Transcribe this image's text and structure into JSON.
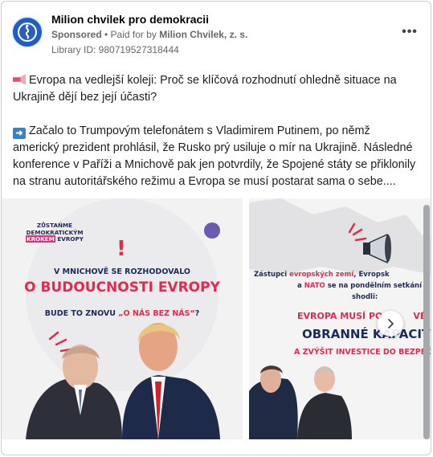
{
  "header": {
    "page_name": "Milion chvilek pro demokracii",
    "sponsored": "Sponsored",
    "paid_for_prefix": " • Paid for by ",
    "payer": "Milion Chvilek, z. s.",
    "library_id": "Library ID: 980719527318444",
    "more_label": "•••"
  },
  "post": {
    "paragraph1": "Evropa na vedlejší koleji: Proč se klíčová rozhodnutí ohledně situace na Ukrajině dějí bez její účasti?",
    "paragraph2": "Začalo to Trumpovým telefonátem s Vladimirem Putinem, po němž americký prezident prohlásil, že Rusko prý usiluje o mír na Ukrajině. Následné konference v Paříži a Mnichově pak jen potvrdily, že Spojené státy se přiklonily na stranu autoritářského režimu a Evropa se musí postarat sama o sebe...."
  },
  "slide1": {
    "tag_line1": "ZŮSTAŇME",
    "tag_line2": "DEMOKRATICKÝM",
    "tag_line3": "KROKEM",
    "tag_line4": "EVROPY",
    "line1": "V MNICHOVĚ SE ROZHODOVALO",
    "line2": "O BUDOUCNOSTI EVROPY",
    "line3_prefix": "BUDE TO ZNOVU ",
    "line3_quote": "„O NÁS BEZ NÁS“",
    "line3_suffix": "?"
  },
  "slide2": {
    "text_line1_a": "Zástupci ",
    "text_line1_b": "evropských zemí",
    "text_line1_c": ", Evropsk",
    "text_line2_a": "a ",
    "text_line2_b": "NATO",
    "text_line2_c": " se na pondělním setkání v",
    "text_line3": "shodli:",
    "headline1": "EVROPA MUSÍ PO",
    "headline1_end": "VÉ",
    "headline2": "OBRANNÉ KAPACITY",
    "headline3": "A ZVÝŠIT INVESTICE DO BEZPEČ"
  },
  "colors": {
    "pink": "#e5294f",
    "navy": "#1e2a5a",
    "brand_blue": "#1f5fbf"
  },
  "icons": {
    "avatar": "milion-chvilek-logo-icon",
    "more": "more-options-icon",
    "next": "chevron-right-icon",
    "megaphone": "megaphone-icon",
    "arrow": "right-arrow-icon"
  }
}
